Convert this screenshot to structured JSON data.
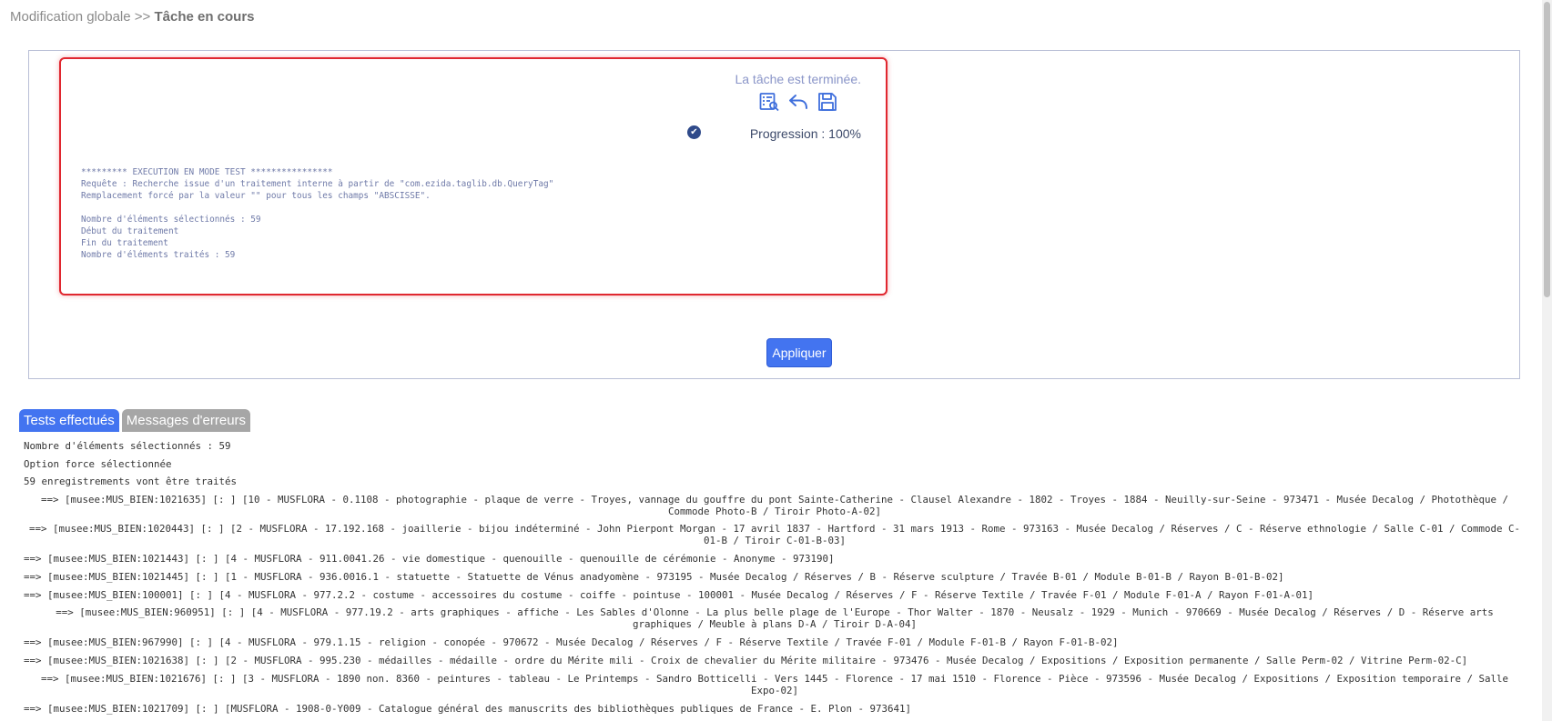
{
  "breadcrumb": {
    "parent": "Modification globale",
    "separator": ">>",
    "current": "Tâche en cours"
  },
  "task": {
    "status": "La tâche est terminée.",
    "progress_label": "Progression : 100%",
    "progress": 100,
    "icons": [
      "report-view-icon",
      "undo-icon",
      "save-icon"
    ],
    "log_lines": [
      "********* EXECUTION EN MODE TEST ****************",
      "Requête : Recherche issue d'un traitement interne à partir de \"com.ezida.taglib.db.QueryTag\"",
      "Remplacement forcé par la valeur \"\" pour tous les champs \"ABSCISSE\".",
      "",
      "Nombre d'éléments sélectionnés : 59",
      "Début du traitement",
      "Fin du traitement",
      "Nombre d'éléments traités : 59"
    ]
  },
  "apply_label": "Appliquer",
  "tabs": [
    {
      "label": "Tests effectués",
      "active": true
    },
    {
      "label": "Messages d'erreurs",
      "active": false
    }
  ],
  "results": {
    "summary": [
      "Nombre d'éléments sélectionnés : 59",
      "Option force sélectionnée",
      "59 enregistrements vont être traités"
    ],
    "entries": [
      "==> [musee:MUS_BIEN:1021635] [: ] [10 - MUSFLORA - 0.1108 - photographie - plaque de verre - Troyes, vannage du gouffre du pont Sainte-Catherine - Clausel Alexandre - 1802 - Troyes - 1884 - Neuilly-sur-Seine - 973471 - Musée Decalog / Photothèque / Commode Photo-B / Tiroir Photo-A-02]",
      "==> [musee:MUS_BIEN:1020443] [: ] [2 - MUSFLORA - 17.192.168 - joaillerie - bijou indéterminé - John Pierpont Morgan - 17 avril 1837 - Hartford - 31 mars 1913 - Rome - 973163 - Musée Decalog / Réserves / C - Réserve ethnologie / Salle C-01 / Commode C-01-B / Tiroir C-01-B-03]",
      "==> [musee:MUS_BIEN:1021443] [: ] [4 - MUSFLORA - 911.0041.26 - vie domestique - quenouille - quenouille de cérémonie - Anonyme - 973190]",
      "==> [musee:MUS_BIEN:1021445] [: ] [1 - MUSFLORA - 936.0016.1 - statuette - Statuette de Vénus anadyomène - 973195 - Musée Decalog / Réserves / B - Réserve sculpture / Travée B-01 / Module B-01-B / Rayon B-01-B-02]",
      "==> [musee:MUS_BIEN:100001] [: ] [4 - MUSFLORA - 977.2.2 - costume - accessoires du costume - coiffe - pointuse - 100001 - Musée Decalog / Réserves / F - Réserve Textile / Travée F-01 / Module F-01-A / Rayon F-01-A-01]",
      "==> [musee:MUS_BIEN:960951] [: ] [4 - MUSFLORA - 977.19.2 - arts graphiques - affiche - Les Sables d'Olonne - La plus belle plage de l'Europe - Thor Walter - 1870 - Neusalz - 1929 - Munich - 970669 - Musée Decalog / Réserves / D - Réserve arts graphiques / Meuble à plans D-A / Tiroir D-A-04]",
      "==> [musee:MUS_BIEN:967990] [: ] [4 - MUSFLORA - 979.1.15 - religion - conopée - 970672 - Musée Decalog / Réserves / F - Réserve Textile / Travée F-01 / Module F-01-B / Rayon F-01-B-02]",
      "==> [musee:MUS_BIEN:1021638] [: ] [2 - MUSFLORA - 995.230 - médailles - médaille - ordre du Mérite mili - Croix de chevalier du Mérite militaire - 973476 - Musée Decalog / Expositions / Exposition permanente / Salle Perm-02 / Vitrine Perm-02-C]",
      "==> [musee:MUS_BIEN:1021676] [: ] [3 - MUSFLORA - 1890 non. 8360 - peintures - tableau - Le Printemps - Sandro Botticelli - Vers 1445 - Florence - 17 mai 1510 - Florence - Pièce - 973596 - Musée Decalog / Expositions / Exposition temporaire / Salle Expo-02]",
      "==> [musee:MUS_BIEN:1021709] [: ] [MUSFLORA - 1908-0-Y009 - Catalogue général des manuscrits des bibliothèques publiques de France - E. Plon - 973641]"
    ]
  }
}
